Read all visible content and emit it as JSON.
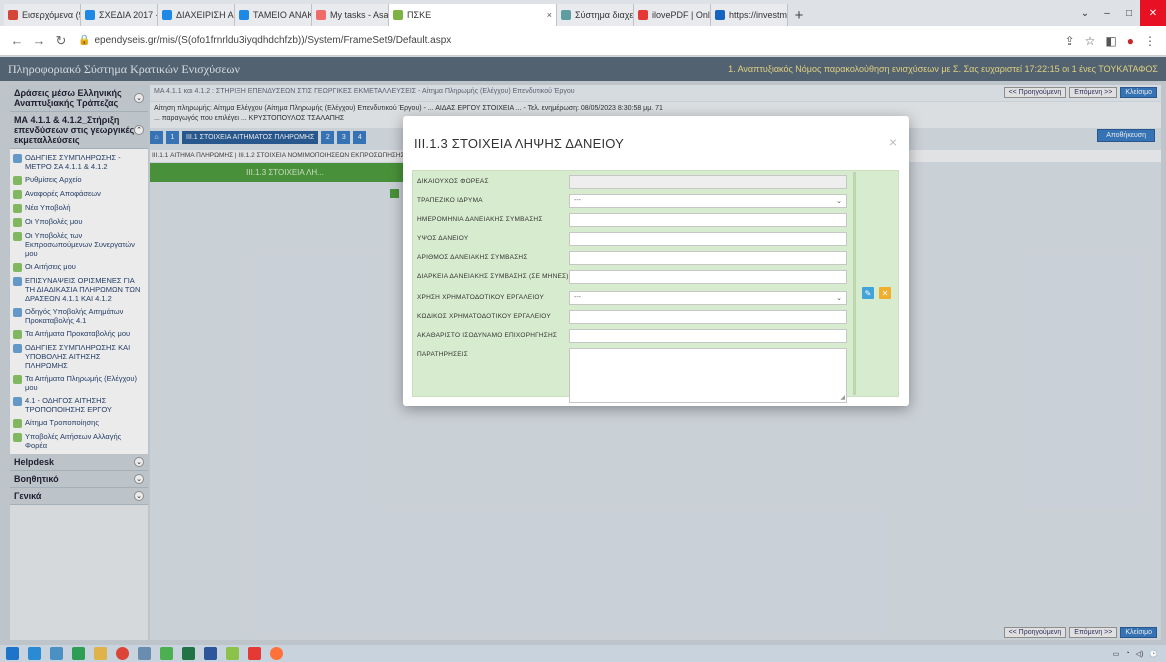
{
  "browser": {
    "tabs": [
      {
        "label": "Εισερχόμενα (9) - karr",
        "color": "#d44638",
        "active": false
      },
      {
        "label": "ΣΧΕΔΙΑ 2017 - ΑΤΤΙΚΗ",
        "color": "#1e88e5",
        "active": false
      },
      {
        "label": "ΔΙΑΧΕΙΡΙΣΗ ΑΝΑΠΤΥ",
        "color": "#1e88e5",
        "active": false
      },
      {
        "label": "ΤΑΜΕΙΟ ΑΝΑΚΑΜΨΗΣ",
        "color": "#1e88e5",
        "active": false
      },
      {
        "label": "My tasks - Asana",
        "color": "#f06a6a",
        "active": false
      },
      {
        "label": "ΠΣΚΕ",
        "color": "#7cb342",
        "active": true
      },
      {
        "label": "Σύστημα διαχείρισης",
        "color": "#5f9ea0",
        "active": false
      },
      {
        "label": "ilovePDF | Online PDF",
        "color": "#e53935",
        "active": false
      },
      {
        "label": "https://investmentaggr",
        "color": "#1565c0",
        "active": false
      }
    ],
    "url": "ependyseis.gr/mis/(S(ofo1frnrldu3iyqdhdchfzb))/System/FrameSet9/Default.aspx"
  },
  "app": {
    "title": "Πληροφοριακό Σύστημα Κρατικών Ενισχύσεων",
    "user_info": "1. Αναπτυξιακός Νόμος παρακολούθηση ενισχύσεων με Σ. Σας ευχαριστεί 17:22:15 οι 1 ένες ΤΟΥΚΑΤΑΦΟΣ"
  },
  "sidebar": {
    "sections": [
      {
        "title": "Δράσεις μέσω Ελληνικής Αναπτυξιακής Τράπεζας",
        "expanded": false,
        "items": []
      },
      {
        "title": "ΜΑ 4.1.1 & 4.1.2_Στήριξη επενδύσεων στις γεωργικές εκμεταλλεύσεις",
        "expanded": true,
        "items": [
          {
            "label": "ΟΔΗΓΙΕΣ ΣΥΜΠΛΗΡΩΣΗΣ - ΜΕΤΡΟ ΣΑ 4.1.1 & 4.1.2",
            "icon": "document-icon"
          },
          {
            "label": "Ρυθμίσεις Αρχείο",
            "icon": "settings-icon"
          },
          {
            "label": "Αναφορές Αποφάσεων",
            "icon": "report-icon"
          },
          {
            "label": "Νέα Υποβολή",
            "icon": "add-icon"
          },
          {
            "label": "Οι Υποβολές μου",
            "icon": "list-icon"
          },
          {
            "label": "Οι Υποβολές των Εκπροσωπούμενων Συνεργατών μου",
            "icon": "list-icon"
          },
          {
            "label": "Οι Αιτήσεις μου",
            "icon": "list-icon"
          },
          {
            "label": "ΕΠΙΣΥΝΑΨΕΙΣ ΟΡΙΣΜΕΝΕΣ ΓΙΑ ΤΗ ΔΙΑΔΙΚΑΣΙΑ ΠΛΗΡΩΜΩΝ ΤΩΝ ΔΡΑΣΕΩΝ 4.1.1 ΚΑΙ 4.1.2",
            "icon": "document-icon"
          },
          {
            "label": "Οδηγός Υποβολής Αιτημάτων Προκαταβολής 4.1",
            "icon": "document-icon"
          },
          {
            "label": "Τα Αιτήματα Προκαταβολής μου",
            "icon": "list-icon"
          },
          {
            "label": "ΟΔΗΓΙΕΣ ΣΥΜΠΛΗΡΩΣΗΣ ΚΑΙ ΥΠΟΒΟΛΗΣ ΑΙΤΗΣΗΣ ΠΛΗΡΩΜΗΣ",
            "icon": "document-icon"
          },
          {
            "label": "Τα Αιτήματα Πληρωμής (Ελέγχου) μου",
            "icon": "list-icon"
          },
          {
            "label": "4.1 - ΟΔΗΓΟΣ ΑΙΤΗΣΗΣ ΤΡΟΠΟΠΟΙΗΣΗΣ ΕΡΓΟΥ",
            "icon": "document-icon"
          },
          {
            "label": "Αίτημα Τροποποίησης",
            "icon": "edit-icon"
          },
          {
            "label": "Υποβολές Αιτήσεων Αλλαγής Φορέα",
            "icon": "list-icon"
          }
        ]
      },
      {
        "title": "Helpdesk",
        "expanded": false,
        "items": []
      },
      {
        "title": "Βοηθητικό",
        "expanded": false,
        "items": []
      },
      {
        "title": "Γενικά",
        "expanded": false,
        "items": []
      }
    ]
  },
  "main": {
    "breadcrumb": "ΜΑ 4.1.1 και 4.1.2 : ΣΤΗΡΙΞΗ ΕΠΕΝΔΥΣΕΩΝ ΣΤΙΣ ΓΕΩΡΓΙΚΕΣ ΕΚΜΕΤΑΛΛΕΥΣΕΙΣ - Αίτημα Πληρωμής (Ελέγχου) Επενδυτικού Έργου",
    "info_line_1": "Αίτηση πληρωμής: Αίτημα Ελέγχου (Αίτημα Πληρωμής (Ελέγχου) Επενδυτικού Έργου) - ... ΑΙΔΑΣ ΕΡΓΟΥ ΣΤΟΙΧΕΙΑ ... - Τελ. ενημέρωση: 08/05/2023 8:30:58 μμ. 71",
    "info_line_2": "... παραγωγός που επιλέγει ... ΚΡΥΣΤΟΠΟΥΛΟΣ ΤΣΑΛΑΠΗΣ",
    "subnav_label": "III.1 ΣΤΟΙΧΕΙΑ ΑΙΤΗΜΑΤΟΣ ΠΛΗΡΩΜΗΣ",
    "subnav_numbers": [
      "1",
      "2",
      "3",
      "4"
    ],
    "subtabs": "III.1.1 ΑΙΤΗΜΑ ΠΛΗΡΩΜΗΣ | III.1.2 ΣΤΟΙΧΕΙΑ ΝΟΜΙΜΟΠΟΙΗΣΕΩΝ ΕΚΠΡΟΣΩΠΗΣΗΣ",
    "green_bar": "III.1.3 ΣΤΟΙΧΕΙΑ ΛΗ...",
    "save_label": "Αποθήκευση",
    "nav": {
      "prev": "<< Προηγούμενη",
      "next": "Επόμενη >>",
      "close": "Κλείσιμο"
    }
  },
  "modal": {
    "title": "III.1.3 ΣΤΟΙΧΕΙΑ ΛΗΨΗΣ ΔΑΝΕΙΟΥ",
    "fields": [
      {
        "label": "ΔΙΚΑΙΟΥΧΟΣ ΦΟΡΕΑΣ",
        "type": "text",
        "value": "",
        "disabled": true
      },
      {
        "label": "ΤΡΑΠΕΖΙΚΟ ΙΔΡΥΜΑ",
        "type": "select",
        "value": "---"
      },
      {
        "label": "ΗΜΕΡΟΜΗΝΙΑ ΔΑΝΕΙΑΚΗΣ ΣΥΜΒΑΣΗΣ",
        "type": "text",
        "value": ""
      },
      {
        "label": "ΥΨΟΣ ΔΑΝΕΙΟΥ",
        "type": "text",
        "value": ""
      },
      {
        "label": "ΑΡΙΘΜΟΣ ΔΑΝΕΙΑΚΗΣ ΣΥΜΒΑΣΗΣ",
        "type": "text",
        "value": ""
      },
      {
        "label": "ΔΙΑΡΚΕΙΑ ΔΑΝΕΙΑΚΗΣ ΣΥΜΒΑΣΗΣ (ΣΕ ΜΗΝΕΣ)",
        "type": "text",
        "value": ""
      },
      {
        "label": "ΧΡΗΣΗ ΧΡΗΜΑΤΟΔΟΤΙΚΟΥ ΕΡΓΑΛΕΙΟΥ",
        "type": "select",
        "value": "---"
      },
      {
        "label": "ΚΩΔΙΚΟΣ ΧΡΗΜΑΤΟΔΟΤΙΚΟΥ ΕΡΓΑΛΕΙΟΥ",
        "type": "text",
        "value": ""
      },
      {
        "label": "ΑΚΑΘΑΡΙΣΤΟ ΙΣΟΔΥΝΑΜΟ ΕΠΙΧΟΡΗΓΗΣΗΣ",
        "type": "text",
        "value": ""
      },
      {
        "label": "ΠΑΡΑΤΗΡΗΣΕΙΣ",
        "type": "textarea",
        "value": ""
      }
    ],
    "close_glyph": "×"
  },
  "colors": {
    "accent_green": "#4f9e3f",
    "modal_body": "#d7ecce",
    "header": "#5a6b7b",
    "save_blue": "#3b7dc4",
    "action_blue": "#42a4d8",
    "action_orange": "#f0ad2e"
  }
}
